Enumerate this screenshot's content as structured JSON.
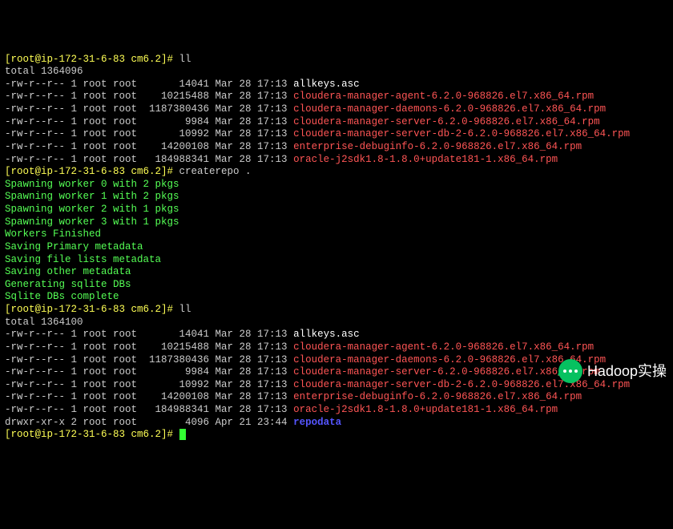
{
  "prompt": "[root@ip-172-31-6-83 cm6.2]# ",
  "commands": {
    "ll1": "ll",
    "createrepo": "createrepo .",
    "ll2": "ll"
  },
  "totals": {
    "before": "total 1364096",
    "after": "total 1364100"
  },
  "listing1": [
    {
      "perm": "-rw-r--r--",
      "links": "1",
      "u": "root",
      "g": "root",
      "size": "      14041",
      "date": "Mar 28 17:13",
      "name": "allkeys.asc",
      "cls": "c-fname"
    },
    {
      "perm": "-rw-r--r--",
      "links": "1",
      "u": "root",
      "g": "root",
      "size": "   10215488",
      "date": "Mar 28 17:13",
      "name": "cloudera-manager-agent-6.2.0-968826.el7.x86_64.rpm",
      "cls": "c-red"
    },
    {
      "perm": "-rw-r--r--",
      "links": "1",
      "u": "root",
      "g": "root",
      "size": " 1187380436",
      "date": "Mar 28 17:13",
      "name": "cloudera-manager-daemons-6.2.0-968826.el7.x86_64.rpm",
      "cls": "c-red"
    },
    {
      "perm": "-rw-r--r--",
      "links": "1",
      "u": "root",
      "g": "root",
      "size": "       9984",
      "date": "Mar 28 17:13",
      "name": "cloudera-manager-server-6.2.0-968826.el7.x86_64.rpm",
      "cls": "c-red"
    },
    {
      "perm": "-rw-r--r--",
      "links": "1",
      "u": "root",
      "g": "root",
      "size": "      10992",
      "date": "Mar 28 17:13",
      "name": "cloudera-manager-server-db-2-6.2.0-968826.el7.x86_64.rpm",
      "cls": "c-red"
    },
    {
      "perm": "-rw-r--r--",
      "links": "1",
      "u": "root",
      "g": "root",
      "size": "   14200108",
      "date": "Mar 28 17:13",
      "name": "enterprise-debuginfo-6.2.0-968826.el7.x86_64.rpm",
      "cls": "c-red"
    },
    {
      "perm": "-rw-r--r--",
      "links": "1",
      "u": "root",
      "g": "root",
      "size": "  184988341",
      "date": "Mar 28 17:13",
      "name": "oracle-j2sdk1.8-1.8.0+update181-1.x86_64.rpm",
      "cls": "c-red"
    }
  ],
  "createrepo_output": [
    "Spawning worker 0 with 2 pkgs",
    "Spawning worker 1 with 2 pkgs",
    "Spawning worker 2 with 1 pkgs",
    "Spawning worker 3 with 1 pkgs",
    "Workers Finished",
    "Saving Primary metadata",
    "Saving file lists metadata",
    "Saving other metadata",
    "Generating sqlite DBs",
    "Sqlite DBs complete"
  ],
  "listing2": [
    {
      "perm": "-rw-r--r--",
      "links": "1",
      "u": "root",
      "g": "root",
      "size": "      14041",
      "date": "Mar 28 17:13",
      "name": "allkeys.asc",
      "cls": "c-fname"
    },
    {
      "perm": "-rw-r--r--",
      "links": "1",
      "u": "root",
      "g": "root",
      "size": "   10215488",
      "date": "Mar 28 17:13",
      "name": "cloudera-manager-agent-6.2.0-968826.el7.x86_64.rpm",
      "cls": "c-red"
    },
    {
      "perm": "-rw-r--r--",
      "links": "1",
      "u": "root",
      "g": "root",
      "size": " 1187380436",
      "date": "Mar 28 17:13",
      "name": "cloudera-manager-daemons-6.2.0-968826.el7.x86_64.rpm",
      "cls": "c-red"
    },
    {
      "perm": "-rw-r--r--",
      "links": "1",
      "u": "root",
      "g": "root",
      "size": "       9984",
      "date": "Mar 28 17:13",
      "name": "cloudera-manager-server-6.2.0-968826.el7.x86_64.rpm",
      "cls": "c-red"
    },
    {
      "perm": "-rw-r--r--",
      "links": "1",
      "u": "root",
      "g": "root",
      "size": "      10992",
      "date": "Mar 28 17:13",
      "name": "cloudera-manager-server-db-2-6.2.0-968826.el7.x86_64.rpm",
      "cls": "c-red"
    },
    {
      "perm": "-rw-r--r--",
      "links": "1",
      "u": "root",
      "g": "root",
      "size": "   14200108",
      "date": "Mar 28 17:13",
      "name": "enterprise-debuginfo-6.2.0-968826.el7.x86_64.rpm",
      "cls": "c-red"
    },
    {
      "perm": "-rw-r--r--",
      "links": "1",
      "u": "root",
      "g": "root",
      "size": "  184988341",
      "date": "Mar 28 17:13",
      "name": "oracle-j2sdk1.8-1.8.0+update181-1.x86_64.rpm",
      "cls": "c-red"
    },
    {
      "perm": "drwxr-xr-x",
      "links": "2",
      "u": "root",
      "g": "root",
      "size": "       4096",
      "date": "Apr 21 23:44",
      "name": "repodata",
      "cls": "c-blue"
    }
  ],
  "watermark": "Hadoop实操"
}
